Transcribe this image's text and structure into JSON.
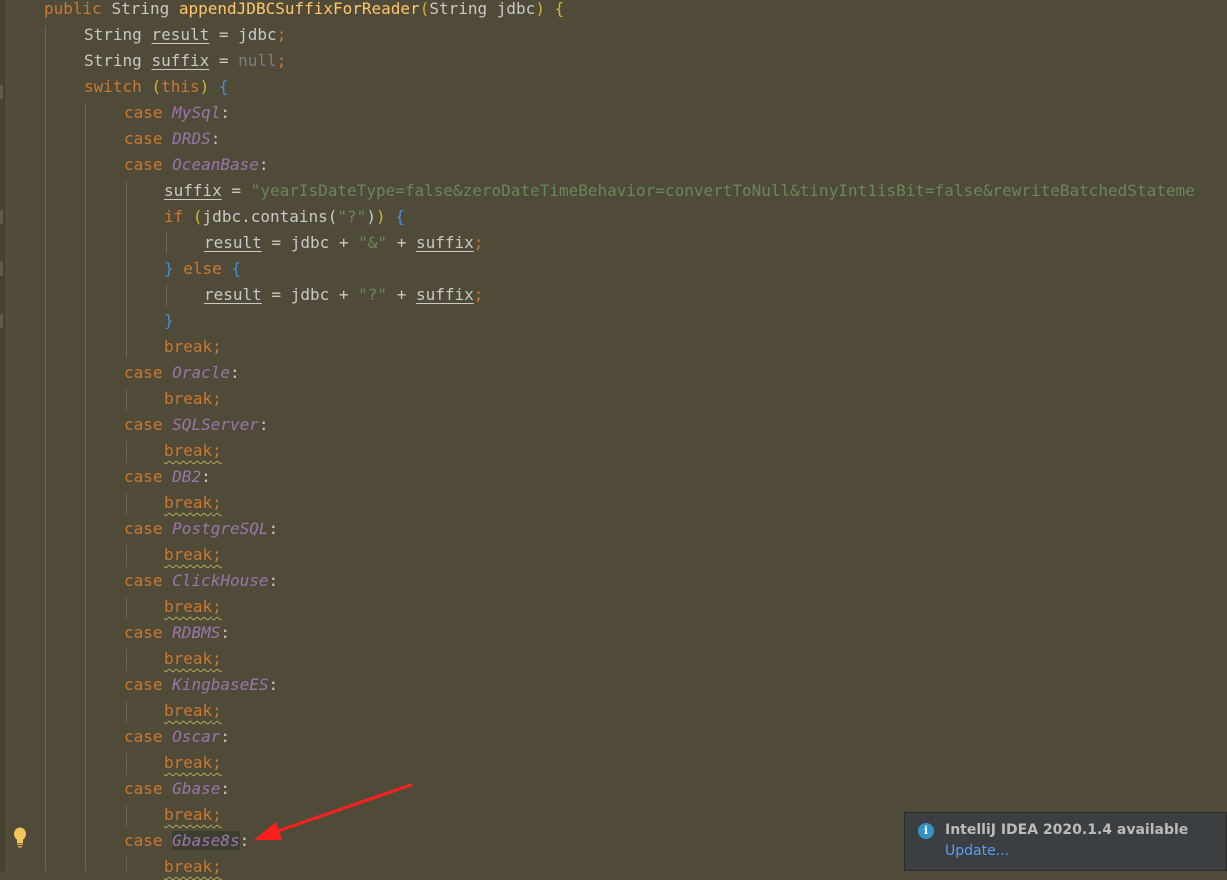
{
  "code": {
    "l1": {
      "a": "public",
      "b": "String",
      "c": "appendJDBCSuffixForReader",
      "d": "(",
      "e": "String jdbc",
      "f": ")",
      "g": "{"
    },
    "l2": {
      "a": "String",
      "b": "result",
      "c": "=",
      "d": "jdbc",
      "e": ";"
    },
    "l3": {
      "a": "String",
      "b": "suffix",
      "c": "=",
      "d": "null",
      "e": ";"
    },
    "l4": {
      "a": "switch",
      "b": "(",
      "c": "this",
      "d": ")",
      "e": "{"
    },
    "case_kw": "case",
    "colon": ":",
    "break_kw": "break",
    "semi": ";",
    "cases": {
      "mysql": "MySql",
      "drds": "DRDS",
      "oceanbase": "OceanBase",
      "oracle": "Oracle",
      "sqlserver": "SQLServer",
      "db2": "DB2",
      "postgresql": "PostgreSQL",
      "clickhouse": "ClickHouse",
      "rdbms": "RDBMS",
      "kingbasees": "KingbaseES",
      "oscar": "Oscar",
      "gbase": "Gbase",
      "gbase8s": "Gbase8s"
    },
    "l8": {
      "a": "suffix",
      "b": "=",
      "c": "\"yearIsDateType=false&zeroDateTimeBehavior=convertToNull&tinyInt1isBit=false&rewriteBatchedStateme"
    },
    "l9": {
      "a": "if",
      "b": "(",
      "c": "jdbc.contains(",
      "d": "\"?\"",
      "e": ")",
      "f": ")",
      "g": "{"
    },
    "l10": {
      "a": "result",
      "b": "= jdbc +",
      "c": "\"&\"",
      "d": "+",
      "e": "suffix",
      "f": ";"
    },
    "l11": {
      "a": "}",
      "b": "else",
      "c": "{"
    },
    "l12": {
      "a": "result",
      "b": "= jdbc +",
      "c": "\"?\"",
      "d": "+",
      "e": "suffix",
      "f": ";"
    },
    "l13": {
      "a": "}"
    }
  },
  "notification": {
    "title": "IntelliJ IDEA 2020.1.4 available",
    "link": "Update..."
  },
  "colors": {
    "background": "#4f4b38",
    "keyword": "#cc7832",
    "method": "#ffc66d",
    "enum_constant": "#9876aa",
    "string": "#6a8759",
    "arrow": "#ff1f1f"
  },
  "icons": {
    "bulb": "lightbulb-icon",
    "info": "info-icon"
  }
}
